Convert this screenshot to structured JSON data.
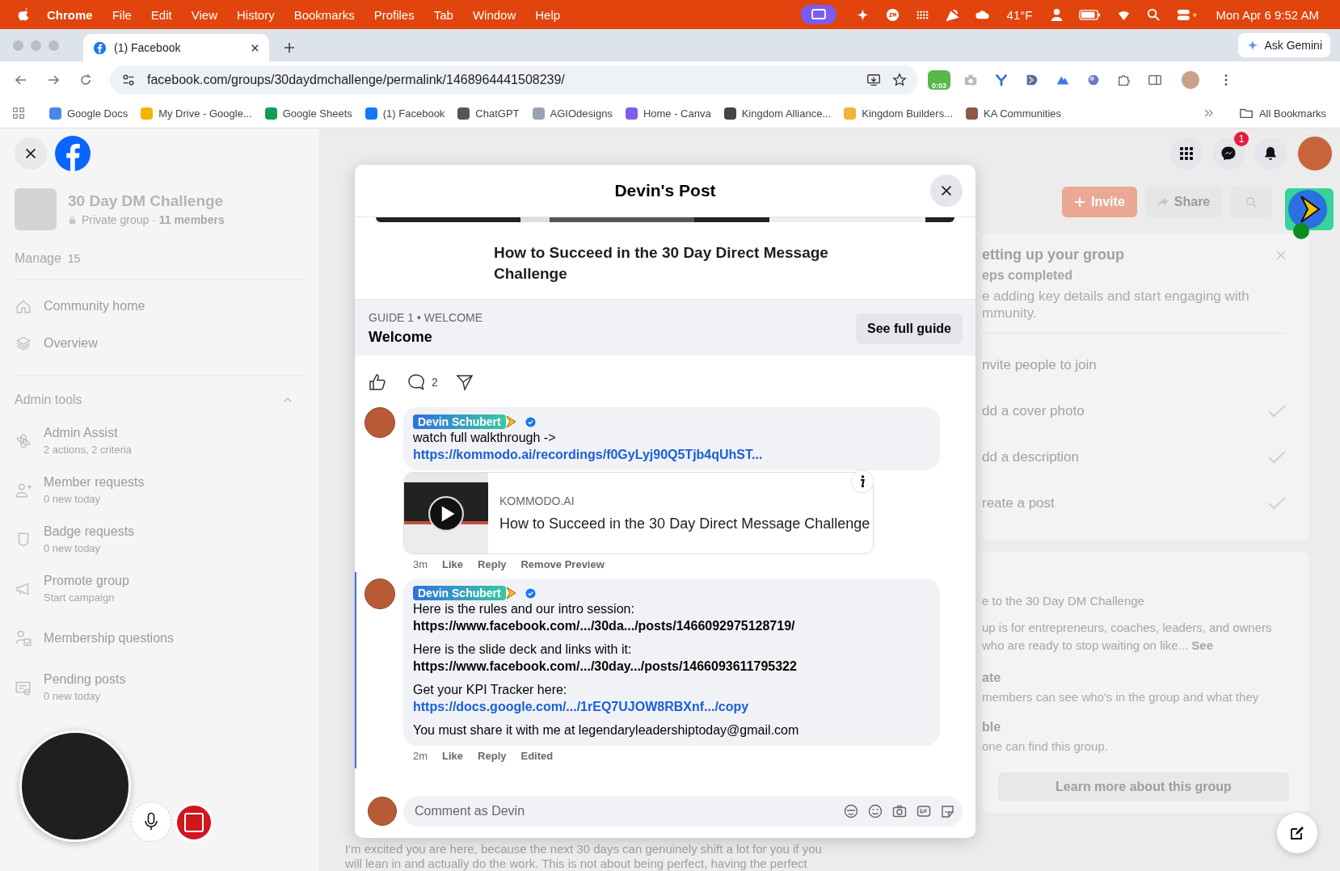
{
  "menu_bar": {
    "app": "Chrome",
    "items": [
      "File",
      "Edit",
      "View",
      "History",
      "Bookmarks",
      "Profiles",
      "Tab",
      "Window",
      "Help"
    ],
    "weather": "41°F",
    "clock": "Mon Apr 6  9:52 AM"
  },
  "browser": {
    "tabs": [
      {
        "title": "(1) Facebook",
        "selected": true
      }
    ],
    "ask_gemini": "Ask Gemini",
    "url": "facebook.com/groups/30daydmchallenge/permalink/1468964441508239/",
    "extension_timer": "0:03",
    "bookmarks": [
      {
        "label": "Google Docs",
        "color": "#4a86e8"
      },
      {
        "label": "My Drive - Google...",
        "color": "#f4b400"
      },
      {
        "label": "Google Sheets",
        "color": "#0f9d58"
      },
      {
        "label": "(1) Facebook",
        "color": "#1877f2"
      },
      {
        "label": "ChatGPT",
        "color": "#555555"
      },
      {
        "label": "AGIOdesigns",
        "color": "#9aa3b5"
      },
      {
        "label": "Home - Canva",
        "color": "#7d5fe8"
      },
      {
        "label": "Kingdom Alliance...",
        "color": "#444444"
      },
      {
        "label": "Kingdom Builders...",
        "color": "#f2b233"
      },
      {
        "label": "KA Communities",
        "color": "#8a5a44"
      }
    ],
    "all_bookmarks": "All Bookmarks"
  },
  "sidebar": {
    "group": {
      "name": "30 Day DM Challenge",
      "privacy": "Private group · **11 members**"
    },
    "manage": {
      "label": "Manage",
      "count": "15"
    },
    "nav": [
      "Community home",
      "Overview"
    ],
    "admin_tools": {
      "title": "Admin tools",
      "expanded": true,
      "items": [
        {
          "label": "Admin Assist",
          "sub": "2 actions, 2 criteria"
        },
        {
          "label": "Member requests",
          "sub": "0 new today"
        },
        {
          "label": "Badge requests",
          "sub": "0 new today"
        },
        {
          "label": "Promote group",
          "sub": "Start campaign"
        },
        {
          "label": "Membership questions"
        },
        {
          "label": "Pending posts",
          "sub": "0 new today"
        }
      ]
    }
  },
  "top_bar": {
    "messenger_badge": "1"
  },
  "group_header": {
    "buttons": [
      "Invite",
      "Share"
    ]
  },
  "setup_card": {
    "title": "etting up your group",
    "progress": "eps completed",
    "text": "e adding key details and start engaging with mmunity.",
    "steps": [
      {
        "label": "nvite people to join",
        "done": false
      },
      {
        "label": "dd a cover photo",
        "done": true
      },
      {
        "label": "dd a description",
        "done": true
      },
      {
        "label": "reate a post",
        "done": true
      }
    ]
  },
  "about_card": {
    "title": "e to the 30 Day DM Challenge",
    "description": "up is for entrepreneurs, coaches, leaders, and owners who are ready to stop waiting on like... **See**",
    "items": [
      {
        "title": "ate",
        "text": "members can see who's in the group and what they"
      },
      {
        "title": "ble",
        "text": "one can find this group."
      }
    ],
    "button": "Learn more about this group"
  },
  "background_post": {
    "lines": [
      "I'm excited you are here, because the next 30 days can genuinely shift a lot for you if you",
      "will lean in and actually do the work. This is not about being perfect, having the perfect"
    ]
  },
  "modal": {
    "title": "Devin's Post",
    "headline": "How to Succeed in the 30 Day Direct Message Challenge",
    "guide": {
      "label": "GUIDE 1 • WELCOME",
      "title": "Welcome",
      "button": "See full guide"
    },
    "comment_count": "2",
    "comments": [
      {
        "author": "Devin Schubert",
        "paragraphs": [
          [
            {
              "kind": "text",
              "text": "watch full walkthrough ->"
            },
            {
              "kind": "link",
              "text": "https://kommodo.ai/recordings/f0GyLyj90Q5Tjb4qUhST..."
            }
          ]
        ],
        "preview": {
          "domain": "KOMMODO.AI",
          "title": "How to Succeed in the 30 Day Direct Message Challenge"
        },
        "meta": [
          "3m",
          "Like",
          "Reply",
          "Remove Preview"
        ]
      },
      {
        "author": "Devin Schubert",
        "paragraphs": [
          [
            {
              "kind": "text",
              "text": "Here is the rules and our intro session:"
            },
            {
              "kind": "bold",
              "text": "https://www.facebook.com/.../30da.../posts/1466092975128719/"
            }
          ],
          [
            {
              "kind": "text",
              "text": "Here is the slide deck and links with it:"
            },
            {
              "kind": "bold",
              "text": "https://www.facebook.com/.../30day.../posts/1466093611795322"
            }
          ],
          [
            {
              "kind": "text",
              "text": "Get your KPI Tracker here:"
            },
            {
              "kind": "link",
              "text": "https://docs.google.com/.../1rEQ7UJOW8RBXnf.../copy"
            }
          ],
          [
            {
              "kind": "text",
              "text": "You must share it with me at legendaryleadershiptoday@gmail.com"
            }
          ]
        ],
        "meta": [
          "2m",
          "Like",
          "Reply",
          "Edited"
        ]
      }
    ],
    "composer": {
      "placeholder": "Comment as Devin"
    }
  }
}
